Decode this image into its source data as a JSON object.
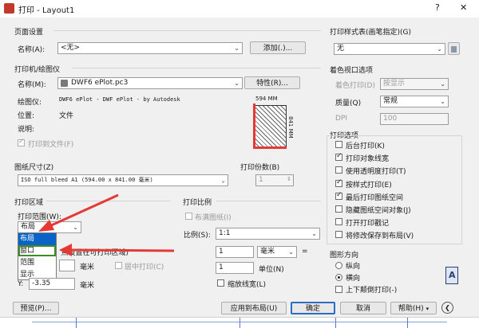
{
  "window": {
    "title": "打印 - Layout1",
    "help_glyph": "?",
    "close_glyph": "✕"
  },
  "page_setup": {
    "group": "页面设置",
    "name_label": "名称(A):",
    "name_value": "<无>",
    "add_button": "添加(.)..."
  },
  "printer": {
    "group": "打印机/绘图仪",
    "name_label": "名称(M):",
    "name_value": "DWF6 ePlot.pc3",
    "properties_button": "特性(R)...",
    "plotter_label": "绘图仪:",
    "plotter_value": "DWF6 ePlot - DWF ePlot - by Autodesk",
    "location_label": "位置:",
    "location_value": "文件",
    "description_label": "说明:",
    "plot_to_file": "打印到文件(F)",
    "preview_width": "594 MM",
    "preview_height": "841 MM"
  },
  "paper_size": {
    "group": "图纸尺寸(Z)",
    "value": "ISO full bleed A1 (594.00 x 841.00 毫米)"
  },
  "copies": {
    "group": "打印份数(B)",
    "value": "1"
  },
  "plot_area": {
    "group": "打印区域",
    "range_label": "打印范围(W):",
    "range_value": "布局",
    "options": [
      "布局",
      "窗口",
      "范围",
      "显示"
    ]
  },
  "plot_offset": {
    "group": "打印偏移(原点设置在可打印区域)",
    "x_value": "",
    "x_unit": "毫米",
    "center": "居中打印(C)",
    "y_label": "Y:",
    "y_value": "-3.35",
    "y_unit": "毫米"
  },
  "plot_scale": {
    "group": "打印比例",
    "fit": "布满图纸(I)",
    "scale_label": "比例(S):",
    "scale_value": "1:1",
    "value1": "1",
    "unit1": "毫米",
    "equals": "=",
    "value2": "1",
    "unit2": "单位(N)",
    "linewidth": "缩放线宽(L)"
  },
  "plot_style": {
    "group": "打印样式表(画笔指定)(G)",
    "value": "无"
  },
  "shaded": {
    "group": "着色视口选项",
    "shade_label": "着色打印(D)",
    "shade_value": "按显示",
    "quality_label": "质量(Q)",
    "quality_value": "常规",
    "dpi_label": "DPI",
    "dpi_value": "100"
  },
  "plot_options": {
    "group": "打印选项",
    "items": [
      {
        "label": "后台打印(K)",
        "checked": false
      },
      {
        "label": "打印对象线宽",
        "checked": true
      },
      {
        "label": "使用透明度打印(T)",
        "checked": false
      },
      {
        "label": "按样式打印(E)",
        "checked": true
      },
      {
        "label": "最后打印图纸空间",
        "checked": true
      },
      {
        "label": "隐藏图纸空间对象(J)",
        "checked": false
      },
      {
        "label": "打开打印戳记",
        "checked": false
      },
      {
        "label": "将修改保存到布局(V)",
        "checked": false
      }
    ]
  },
  "orientation": {
    "group": "图形方向",
    "portrait": "纵向",
    "landscape": "横向",
    "upside": "上下颠倒打印(-)",
    "icon_glyph": "A"
  },
  "footer": {
    "preview": "预览(P)...",
    "apply": "应用到布局(U)",
    "ok": "确定",
    "cancel": "取消",
    "help": "帮助(H)",
    "expand_glyph": "❮"
  },
  "colors": {
    "annotation_red": "#e53935",
    "selection_blue": "#0a64c8",
    "highlight_box": "#3c8c28"
  }
}
